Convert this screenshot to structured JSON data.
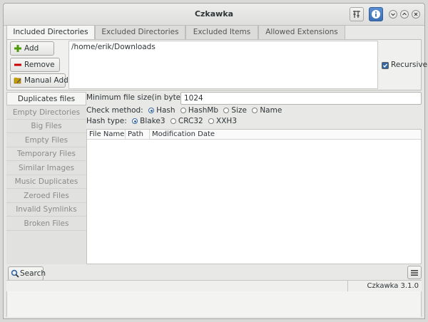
{
  "window": {
    "title": "Czkawka"
  },
  "tabs": [
    {
      "label": "Included Directories"
    },
    {
      "label": "Excluded Directories"
    },
    {
      "label": "Excluded Items"
    },
    {
      "label": "Allowed Extensions"
    }
  ],
  "dir_buttons": {
    "add": "Add",
    "remove": "Remove",
    "manual_add": "Manual Add"
  },
  "directories": [
    "/home/erik/Downloads"
  ],
  "recursive": {
    "label": "Recursive",
    "checked": true
  },
  "sidebar": {
    "items": [
      {
        "label": "Duplicates files",
        "active": true
      },
      {
        "label": "Empty Directories"
      },
      {
        "label": "Big Files"
      },
      {
        "label": "Empty Files"
      },
      {
        "label": "Temporary Files"
      },
      {
        "label": "Similar Images"
      },
      {
        "label": "Music Duplicates"
      },
      {
        "label": "Zeroed Files"
      },
      {
        "label": "Invalid Symlinks"
      },
      {
        "label": "Broken Files"
      }
    ]
  },
  "options": {
    "min_size_label": "Minimum file size(in bytes)",
    "min_size_value": "1024",
    "check_method_label": "Check method:",
    "check_methods": [
      "Hash",
      "HashMb",
      "Size",
      "Name"
    ],
    "check_method_selected": "Hash",
    "hash_type_label": "Hash type:",
    "hash_types": [
      "Blake3",
      "CRC32",
      "XXH3"
    ],
    "hash_type_selected": "Blake3"
  },
  "results": {
    "columns": [
      "File Name",
      "Path",
      "Modification Date"
    ]
  },
  "bottom": {
    "search_label": "Search"
  },
  "status": {
    "version": "Czkawka 3.1.0"
  },
  "colors": {
    "accent": "#3465a4",
    "info_button": "#4a7fc4",
    "add_icon": "#4e9a06",
    "remove_icon": "#cc0000"
  }
}
